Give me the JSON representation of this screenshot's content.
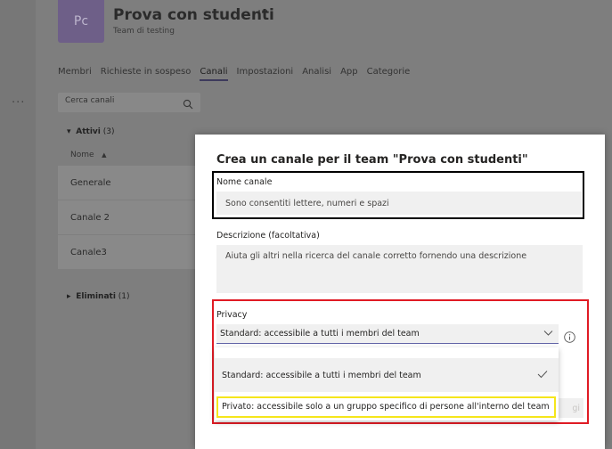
{
  "team": {
    "avatar_initials": "Pc",
    "name": "Prova con studenti",
    "more": "···",
    "subtitle": "Team di testing"
  },
  "rail": {
    "more": "···"
  },
  "tabs": [
    {
      "label": "Membri"
    },
    {
      "label": "Richieste in sospeso"
    },
    {
      "label": "Canali",
      "active": true
    },
    {
      "label": "Impostazioni"
    },
    {
      "label": "Analisi"
    },
    {
      "label": "App"
    },
    {
      "label": "Categorie"
    }
  ],
  "channel_search": {
    "placeholder": "Cerca canali"
  },
  "active_section": {
    "label": "Attivi",
    "count": "(3)"
  },
  "column_header": {
    "label": "Nome",
    "sort_arrow": "▲"
  },
  "channels": [
    {
      "name": "Generale"
    },
    {
      "name": "Canale 2"
    },
    {
      "name": "Canale3"
    }
  ],
  "deleted_section": {
    "label": "Eliminati",
    "count": "(1)"
  },
  "dialog": {
    "title": "Crea un canale per il team \"Prova con studenti\"",
    "name_label": "Nome canale",
    "name_placeholder": "Sono consentiti lettere, numeri e spazi",
    "description_label": "Descrizione (facoltativa)",
    "description_placeholder": "Aiuta gli altri nella ricerca del canale corretto fornendo una descrizione",
    "privacy_label": "Privacy",
    "privacy_selected": "Standard: accessibile a tutti i membri del team",
    "privacy_options": [
      {
        "label": "Standard: accessibile a tutti i membri del team",
        "selected": true
      },
      {
        "label": "Privato: accessibile solo a un gruppo specifico di persone all'interno del team",
        "selected": false
      }
    ],
    "add_button_partial": "gi"
  },
  "highlight_colors": {
    "name_box": "#000000",
    "privacy_box": "#e01b24",
    "private_option_box": "#f5e61b"
  },
  "accent_color": "#6264a7"
}
